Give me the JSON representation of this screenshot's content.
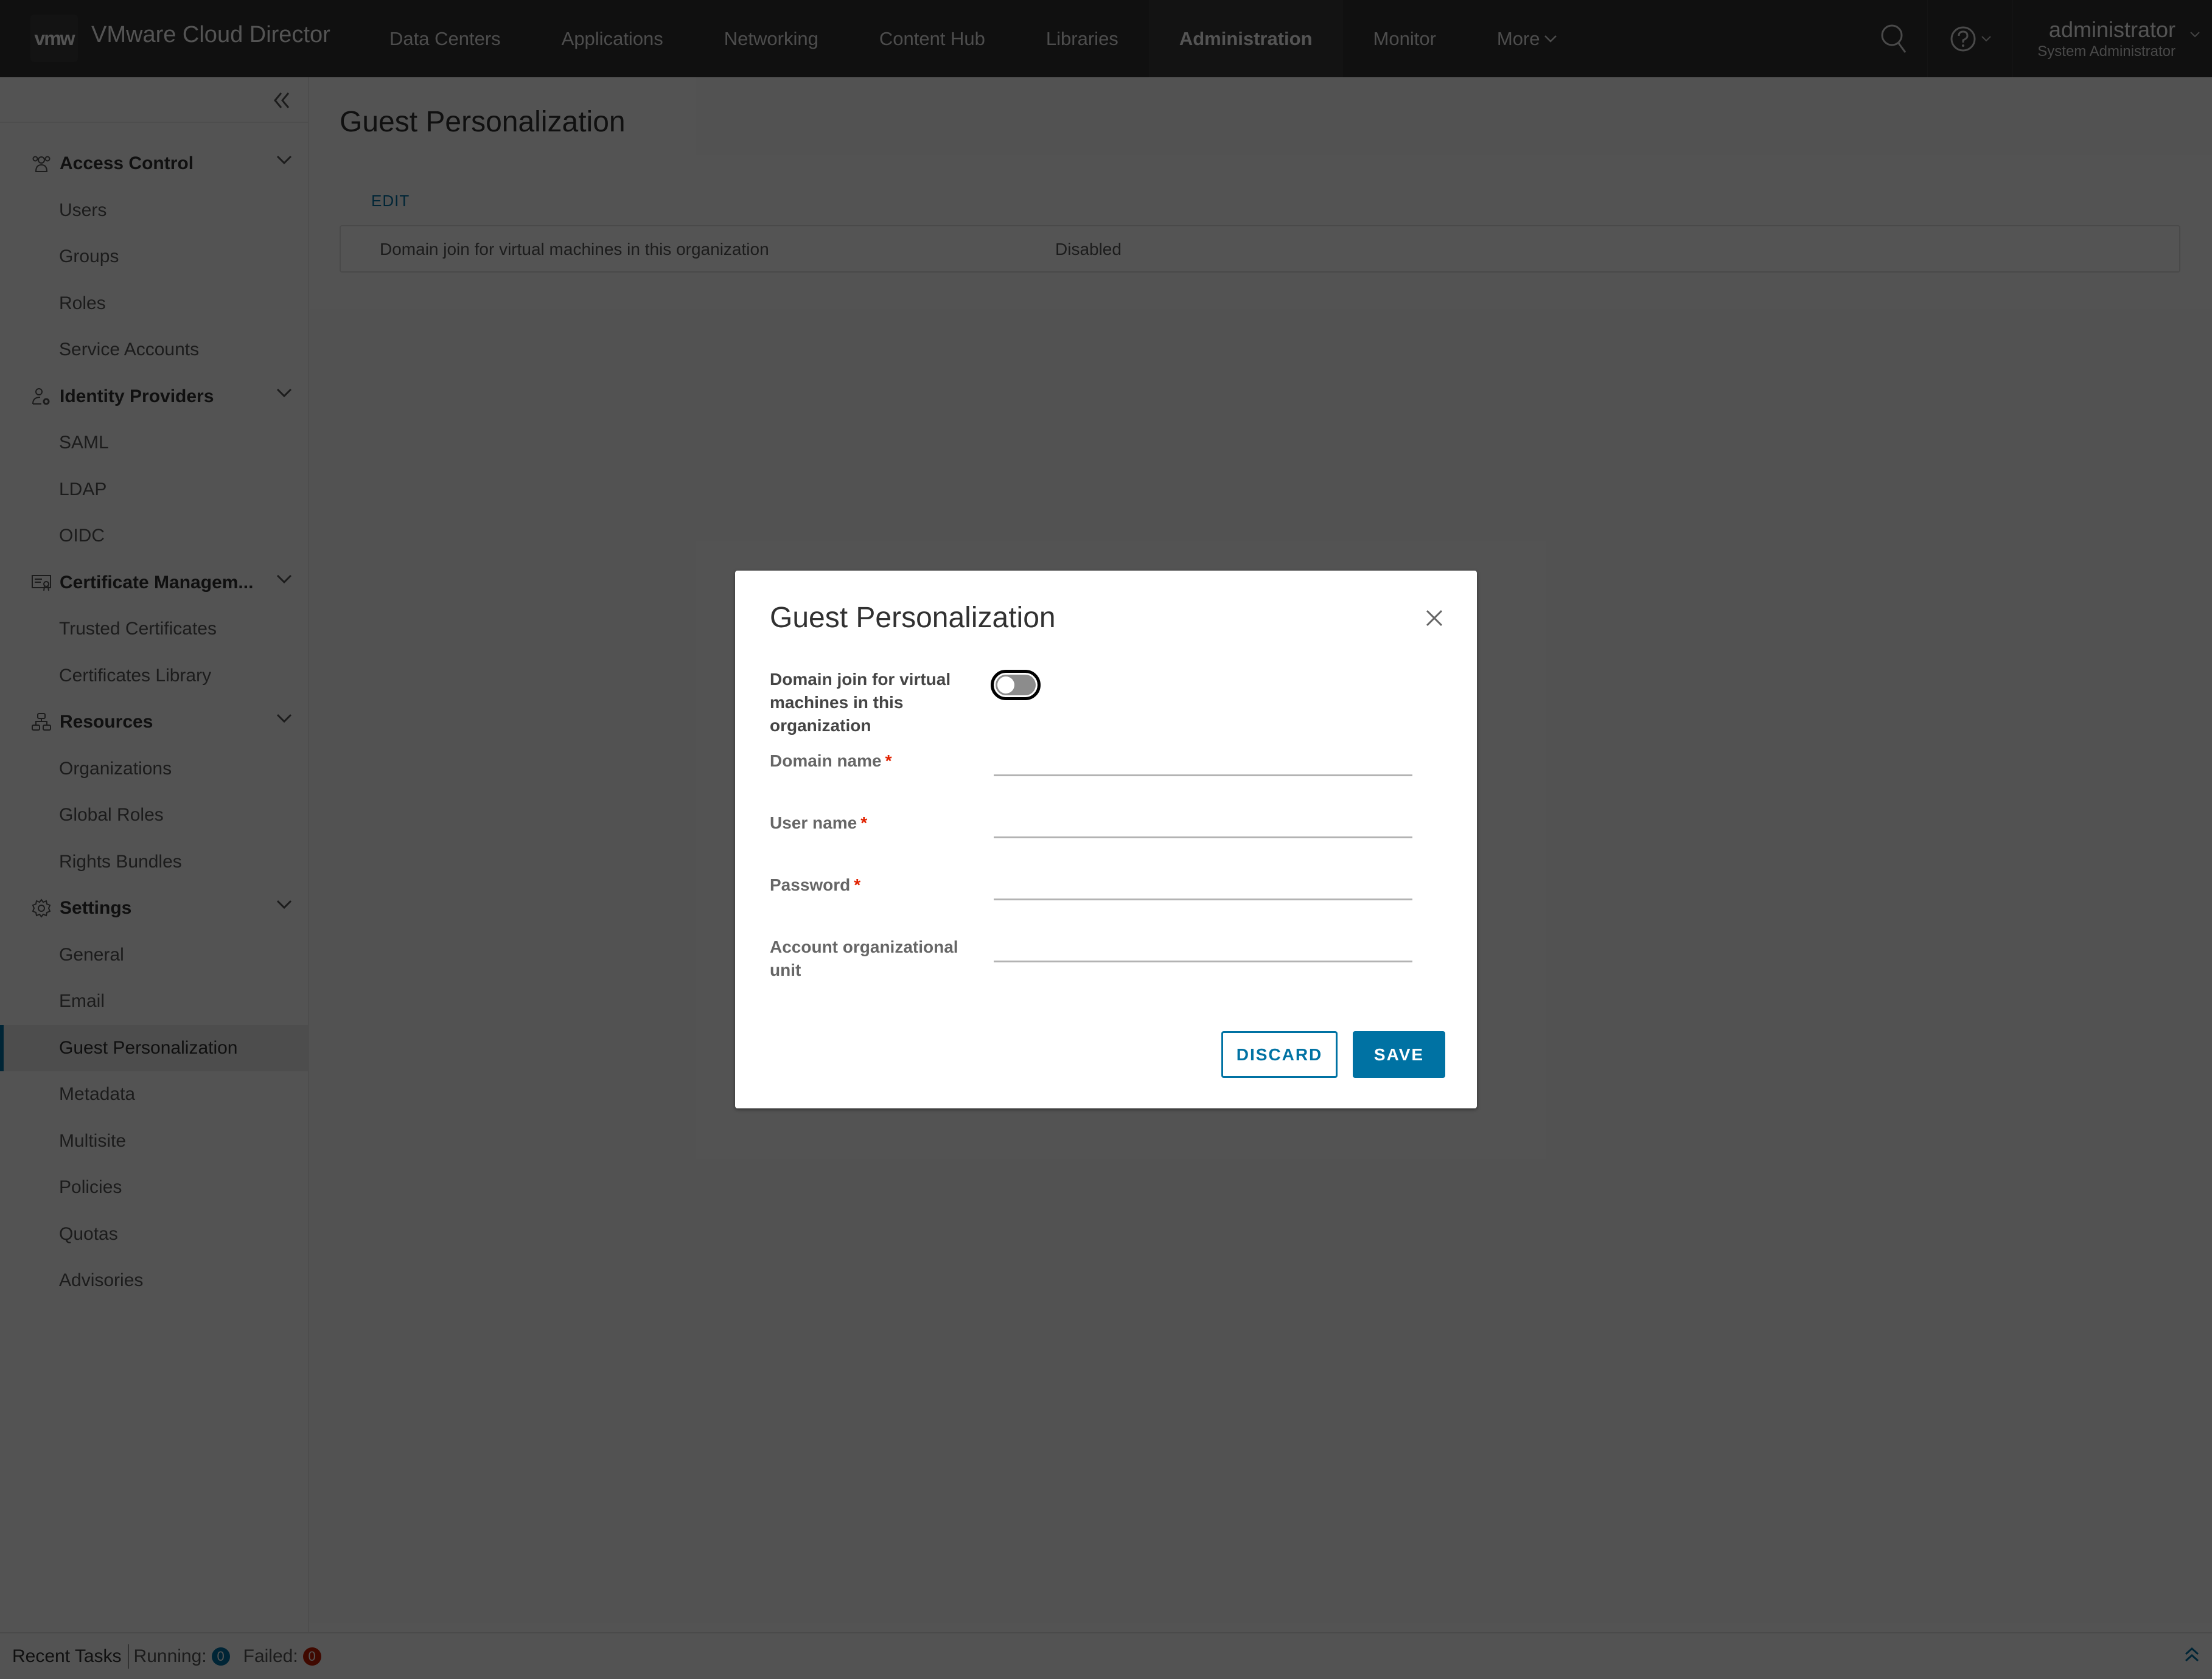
{
  "header": {
    "logo_text": "vmw",
    "app_title": "VMware Cloud Director",
    "nav": [
      {
        "label": "Data Centers",
        "active": false
      },
      {
        "label": "Applications",
        "active": false
      },
      {
        "label": "Networking",
        "active": false
      },
      {
        "label": "Content Hub",
        "active": false
      },
      {
        "label": "Libraries",
        "active": false
      },
      {
        "label": "Administration",
        "active": true
      },
      {
        "label": "Monitor",
        "active": false
      },
      {
        "label": "More",
        "active": false
      }
    ],
    "more_caret": "⌄",
    "user": {
      "name": "administrator",
      "role": "System Administrator"
    }
  },
  "sidebar": {
    "collapse_icon": "«",
    "groups": [
      {
        "label": "Access Control",
        "icon": "users-icon",
        "items": [
          "Users",
          "Groups",
          "Roles",
          "Service Accounts"
        ]
      },
      {
        "label": "Identity Providers",
        "icon": "user-settings-icon",
        "items": [
          "SAML",
          "LDAP",
          "OIDC"
        ]
      },
      {
        "label": "Certificate Managem...",
        "icon": "certificate-icon",
        "items": [
          "Trusted Certificates",
          "Certificates Library"
        ]
      },
      {
        "label": "Resources",
        "icon": "network-icon",
        "items": [
          "Organizations",
          "Global Roles",
          "Rights Bundles"
        ]
      },
      {
        "label": "Settings",
        "icon": "gear-icon",
        "items": [
          "General",
          "Email",
          "Guest Personalization",
          "Metadata",
          "Multisite",
          "Policies",
          "Quotas",
          "Advisories"
        ]
      }
    ],
    "active_item": "Guest Personalization"
  },
  "page": {
    "title": "Guest Personalization",
    "edit_label": "EDIT",
    "setting_key": "Domain join for virtual machines in this organization",
    "setting_value": "Disabled"
  },
  "footer": {
    "recent_tasks": "Recent Tasks",
    "running_label": "Running:",
    "running_count": "0",
    "failed_label": "Failed:",
    "failed_count": "0"
  },
  "modal": {
    "title": "Guest Personalization",
    "toggle_label": "Domain join for virtual machines in this organization",
    "toggle_on": false,
    "fields": [
      {
        "label": "Domain name",
        "required": true,
        "value": ""
      },
      {
        "label": "User name",
        "required": true,
        "value": ""
      },
      {
        "label": "Password",
        "required": true,
        "value": ""
      },
      {
        "label": "Account organizational unit",
        "required": false,
        "value": ""
      }
    ],
    "required_mark": "*",
    "discard_label": "DISCARD",
    "save_label": "SAVE"
  },
  "colors": {
    "accent": "#0072a3",
    "running_badge": "#0072a3",
    "failed_badge": "#c21d00",
    "required": "#e12200"
  }
}
